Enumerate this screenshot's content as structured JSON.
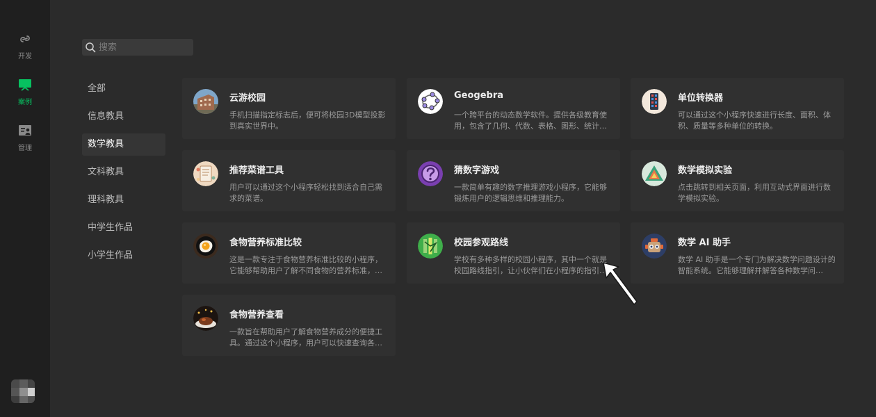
{
  "rail": {
    "items": [
      {
        "label": "开发",
        "icon": "link-icon"
      },
      {
        "label": "案例",
        "icon": "case-icon",
        "active": true
      },
      {
        "label": "管理",
        "icon": "manage-icon"
      }
    ]
  },
  "search": {
    "placeholder": "搜索"
  },
  "categories": [
    {
      "label": "全部"
    },
    {
      "label": "信息教具"
    },
    {
      "label": "数学教具",
      "active": true
    },
    {
      "label": "文科教具"
    },
    {
      "label": "理科教具"
    },
    {
      "label": "中学生作品"
    },
    {
      "label": "小学生作品"
    }
  ],
  "cards": [
    {
      "title": "云游校园",
      "desc": "手机扫描指定标志后，便可将校园3D模型投影到真实世界中。",
      "icon": "campus-building-icon"
    },
    {
      "title": "Geogebra",
      "desc": "一个跨平台的动态数学软件。提供各级教育使用，包含了几何、代数、表格、图形、统计…",
      "icon": "geogebra-icon"
    },
    {
      "title": "单位转换器",
      "desc": "可以通过这个小程序快速进行长度、面积、体积、质量等多种单位的转换。",
      "icon": "ruler-icon"
    },
    {
      "title": "推荐菜谱工具",
      "desc": "用户可以通过这个小程序轻松找到适合自己需求的菜谱。",
      "icon": "recipe-icon"
    },
    {
      "title": "猜数字游戏",
      "desc": "一款简单有趣的数字推理游戏小程序，它能够锻炼用户的逻辑思维和推理能力。",
      "icon": "question-mark-icon"
    },
    {
      "title": "数学模拟实验",
      "desc": "点击跳转到相关页面，利用互动式界面进行数学模拟实验。",
      "icon": "triangle-icon"
    },
    {
      "title": "食物营养标准比较",
      "desc": "这是一款专注于食物营养标准比较的小程序，它能够帮助用户了解不同食物的营养标准，…",
      "icon": "fried-egg-icon"
    },
    {
      "title": "校园参观路线",
      "desc": "学校有多种多样的校园小程序，其中一个就是校园路线指引，让小伙伴们在小程序的指引…",
      "icon": "map-route-icon"
    },
    {
      "title": "数学 AI 助手",
      "desc": "数学 AI 助手是一个专门为解决数学问题设计的智能系统。它能够理解并解答各种数学问…",
      "icon": "robot-icon"
    },
    {
      "title": "食物营养查看",
      "desc": "一款旨在帮助用户了解食物营养成分的便捷工具。通过这个小程序，用户可以快速查询各…",
      "icon": "food-plate-icon"
    }
  ],
  "colors": {
    "accent": "#07c160",
    "background": "#2b2b2b",
    "rail": "#1f1f1f",
    "card": "#303030"
  }
}
